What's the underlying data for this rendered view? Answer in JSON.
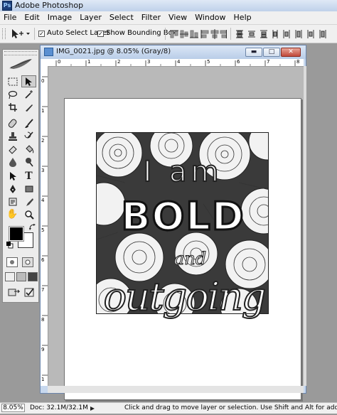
{
  "app": {
    "title": "Adobe Photoshop",
    "icon": "photoshop-app-icon"
  },
  "menu": [
    "File",
    "Edit",
    "Image",
    "Layer",
    "Select",
    "Filter",
    "View",
    "Window",
    "Help"
  ],
  "options": {
    "auto_select_label": "Auto Select Layer",
    "auto_select_checked": true,
    "bounding_box_label": "Show Bounding Box",
    "bounding_box_checked": true
  },
  "document": {
    "title": "IMG_0021.jpg @ 8.05% (Gray/8)",
    "ruler_h_labels": [
      "0",
      "1",
      "2",
      "3",
      "4",
      "5",
      "6",
      "7",
      "8"
    ],
    "ruler_v_labels": [
      "0",
      "1",
      "2",
      "3",
      "4",
      "5",
      "6",
      "7",
      "8",
      "9",
      "1",
      "1"
    ]
  },
  "artwork": {
    "line1": "I am",
    "line2": "BOLD",
    "line3": "and",
    "line4": "outgoing"
  },
  "status": {
    "zoom": "8.05%",
    "doc_size": "Doc: 32.1M/32.1M",
    "hint": "Click and drag to move layer or selection.  Use Shift and Alt for additional o"
  },
  "colors": {
    "foreground": "#000000",
    "background": "#ffffff",
    "accent": "#c7d8ee"
  }
}
